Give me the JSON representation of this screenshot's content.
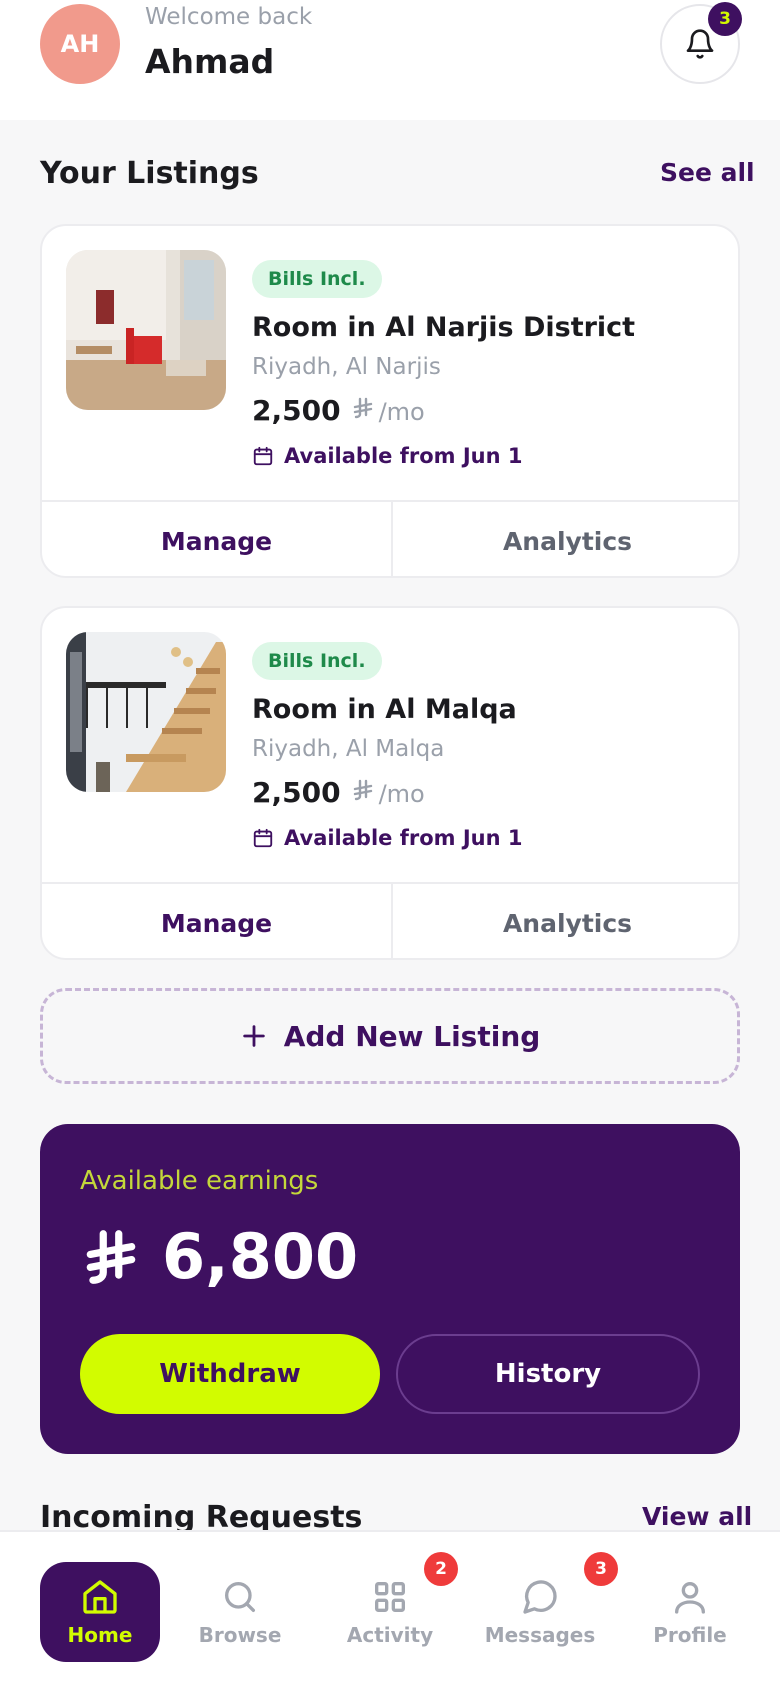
{
  "header": {
    "avatar_initials": "AH",
    "welcome": "Welcome back",
    "name": "Ahmad",
    "notification_count": "3"
  },
  "listings_section": {
    "title": "Your Listings",
    "see_all": "See all"
  },
  "listings": [
    {
      "tag": "Bills Incl.",
      "title": "Room in Al Narjis District",
      "location": "Riyadh, Al Narjis",
      "price": "2,500",
      "currency_symbol": "riyal-icon",
      "per": "/mo",
      "available": "Available from Jun 1",
      "manage": "Manage",
      "analytics": "Analytics"
    },
    {
      "tag": "Bills Incl.",
      "title": "Room in Al Malqa",
      "location": "Riyadh, Al Malqa",
      "price": "2,500",
      "currency_symbol": "riyal-icon",
      "per": "/mo",
      "available": "Available from Jun 1",
      "manage": "Manage",
      "analytics": "Analytics"
    }
  ],
  "add_listing": {
    "label": "Add New Listing"
  },
  "earnings": {
    "label": "Available earnings",
    "amount": "6,800",
    "withdraw": "Withdraw",
    "history": "History"
  },
  "requests_section": {
    "title": "Incoming Requests",
    "view_all": "View all"
  },
  "nav": {
    "items": [
      {
        "label": "Home",
        "icon": "home-icon",
        "active": true
      },
      {
        "label": "Browse",
        "icon": "search-icon"
      },
      {
        "label": "Activity",
        "icon": "grid-icon",
        "badge": "2"
      },
      {
        "label": "Messages",
        "icon": "chat-icon",
        "badge": "3"
      },
      {
        "label": "Profile",
        "icon": "user-icon"
      }
    ]
  },
  "colors": {
    "brand_purple": "#3e1060",
    "accent_lime": "#d2fc00",
    "tag_green_bg": "#dcf7e6",
    "tag_green_text": "#1e8a4a",
    "badge_red": "#ef3b3b"
  }
}
